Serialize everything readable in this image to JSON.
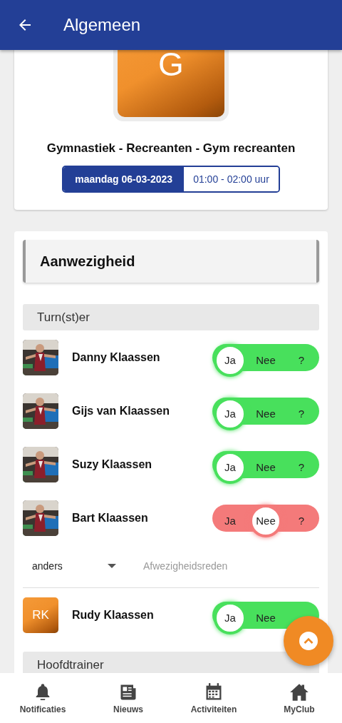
{
  "header": {
    "title": "Algemeen"
  },
  "event": {
    "logo_letter": "G",
    "title": "Gymnastiek - Recreanten - Gym recreanten",
    "date": "maandag 06-03-2023",
    "time": "01:00 - 02:00 uur"
  },
  "attendance": {
    "title": "Aanwezigheid",
    "groups": [
      {
        "title": "Turn(st)er",
        "members": [
          {
            "name": "Danny Klaassen",
            "avatar": {
              "kind": "picture"
            },
            "options": [
              {
                "label": "Ja",
                "selected": true
              },
              {
                "label": "Nee",
                "selected": false
              },
              {
                "label": "?",
                "selected": false
              }
            ]
          },
          {
            "name": "Gijs van Klaassen",
            "avatar": {
              "kind": "picture"
            },
            "options": [
              {
                "label": "Ja",
                "selected": true
              },
              {
                "label": "Nee",
                "selected": false
              },
              {
                "label": "?",
                "selected": false
              }
            ]
          },
          {
            "name": "Suzy Klaassen",
            "avatar": {
              "kind": "picture"
            },
            "options": [
              {
                "label": "Ja",
                "selected": true
              },
              {
                "label": "Nee",
                "selected": false
              },
              {
                "label": "?",
                "selected": false
              }
            ]
          },
          {
            "name": "Bart Klaassen",
            "avatar": {
              "kind": "picture"
            },
            "options": [
              {
                "label": "Ja",
                "selected": false
              },
              {
                "label": "Nee",
                "selected": true
              },
              {
                "label": "?",
                "selected": false
              }
            ],
            "absence": {
              "reason": "anders",
              "placeholder": "Afwezigheidsreden"
            }
          },
          {
            "name": "Rudy Klaassen",
            "avatar": {
              "kind": "initials",
              "text": "RK"
            },
            "options": [
              {
                "label": "Ja",
                "selected": true
              },
              {
                "label": "Nee",
                "selected": false
              }
            ]
          }
        ]
      },
      {
        "title": "Hoofdtrainer"
      }
    ]
  },
  "bottom_nav": [
    {
      "label": "Notificaties"
    },
    {
      "label": "Nieuws"
    },
    {
      "label": "Activiteiten"
    },
    {
      "label": "MyClub"
    }
  ]
}
